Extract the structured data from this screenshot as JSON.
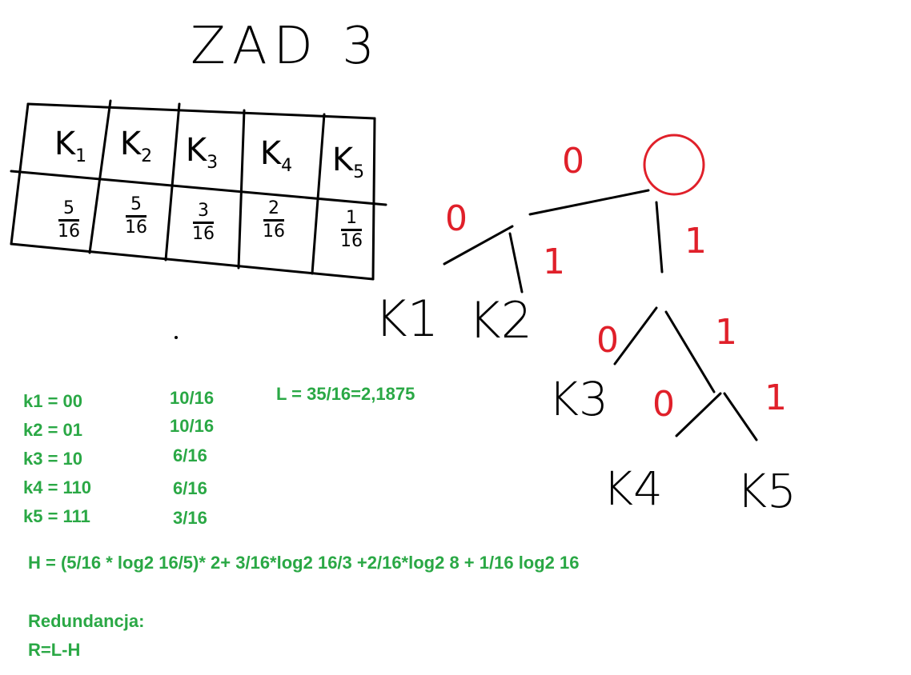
{
  "title": "ZAD 3",
  "table": {
    "symbols": [
      {
        "base": "K",
        "sub": "1"
      },
      {
        "base": "K",
        "sub": "2"
      },
      {
        "base": "K",
        "sub": "3"
      },
      {
        "base": "K",
        "sub": "4"
      },
      {
        "base": "K",
        "sub": "5"
      }
    ],
    "probabilities": [
      {
        "num": "5",
        "den": "16"
      },
      {
        "num": "5",
        "den": "16"
      },
      {
        "num": "3",
        "den": "16"
      },
      {
        "num": "2",
        "den": "16"
      },
      {
        "num": "1",
        "den": "16"
      }
    ]
  },
  "tree": {
    "leaves": [
      "K1",
      "K2",
      "K3",
      "K4",
      "K5"
    ],
    "edge_labels_zero": "0",
    "edge_labels_one": "1"
  },
  "codes": [
    {
      "label": "k1 = 00",
      "contrib": "10/16"
    },
    {
      "label": "k2 = 01",
      "contrib": "10/16"
    },
    {
      "label": "k3 = 10",
      "contrib": "6/16"
    },
    {
      "label": "k4 = 110",
      "contrib": "6/16"
    },
    {
      "label": "k5 = 111",
      "contrib": "3/16"
    }
  ],
  "avg_length": "L  = 35/16=2,1875",
  "entropy": "H = (5/16 * log2 16/5)* 2+ 3/16*log2 16/3 +2/16*log2 8 + 1/16 log2 16",
  "redundancy_label": "Redundancja:",
  "redundancy_formula": "R=L-H",
  "colors": {
    "ink": "#000000",
    "red": "#e0202a",
    "green": "#2aa845"
  }
}
